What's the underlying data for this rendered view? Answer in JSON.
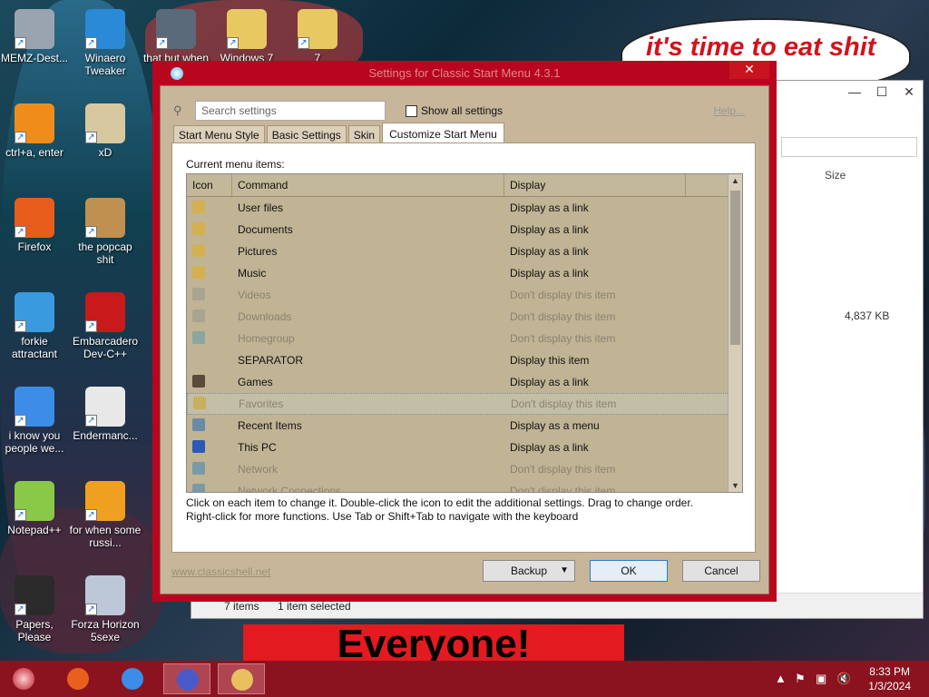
{
  "desktop": {
    "icons": [
      {
        "label": "MEMZ-Dest...",
        "color": "#9aa4b0"
      },
      {
        "label": "Winaero Tweaker",
        "color": "#2a8ad8"
      },
      {
        "label": "that but when",
        "color": "#5a6a7a"
      },
      {
        "label": "Windows 7",
        "color": "#e8c860"
      },
      {
        "label": "7",
        "color": "#e8c860"
      },
      {
        "label": "ctrl+a, enter",
        "color": "#f08c1a"
      },
      {
        "label": "xD",
        "color": "#d8c8a0"
      },
      {
        "label": "Firefox",
        "color": "#e85d1c"
      },
      {
        "label": "the popcap shit",
        "color": "#c09050"
      },
      {
        "label": "forkie attractant",
        "color": "#3a9ae0"
      },
      {
        "label": "Embarcadero Dev-C++",
        "color": "#c81a1a"
      },
      {
        "label": "i know you people we...",
        "color": "#3b8de8"
      },
      {
        "label": "Endermanc...",
        "color": "#e8e8e8"
      },
      {
        "label": "Notepad++",
        "color": "#8ac848"
      },
      {
        "label": "for when some russi...",
        "color": "#f0a020"
      },
      {
        "label": "Papers, Please",
        "color": "#2a2a2a"
      },
      {
        "label": "Forza Horizon 5sexe",
        "color": "#bcc8d8"
      }
    ],
    "meme_top": "it's time to eat shit",
    "meme_bottom": "Everyone!"
  },
  "explorer": {
    "size_header": "Size",
    "size_value": "4,837 KB",
    "items_count": "7 items",
    "selected": "1 item selected",
    "min": "—",
    "max": "☐",
    "close": "✕"
  },
  "dialog": {
    "title": "Settings for Classic Start Menu 4.3.1",
    "close": "✕",
    "search_placeholder": "Search settings",
    "show_all": "Show all settings",
    "help": "Help...",
    "tabs": [
      "Start Menu Style",
      "Basic Settings",
      "Skin",
      "Customize Start Menu"
    ],
    "list_label": "Current menu items:",
    "columns": [
      "Icon",
      "Command",
      "Display"
    ],
    "rows": [
      {
        "command": "User files",
        "display": "Display as a link",
        "dim": false,
        "icon_color": "#d4b050"
      },
      {
        "command": "Documents",
        "display": "Display as a link",
        "dim": false,
        "icon_color": "#d4b050"
      },
      {
        "command": "Pictures",
        "display": "Display as a link",
        "dim": false,
        "icon_color": "#d4b050"
      },
      {
        "command": "Music",
        "display": "Display as a link",
        "dim": false,
        "icon_color": "#d4b050"
      },
      {
        "command": "Videos",
        "display": "Don't display this item",
        "dim": true,
        "icon_color": "#a9a48f"
      },
      {
        "command": "Downloads",
        "display": "Don't display this item",
        "dim": true,
        "icon_color": "#a9a48f"
      },
      {
        "command": "Homegroup",
        "display": "Don't display this item",
        "dim": true,
        "icon_color": "#8aa6a0"
      },
      {
        "command": "SEPARATOR",
        "display": "Display this item",
        "dim": false,
        "icon_color": ""
      },
      {
        "command": "Games",
        "display": "Display as a link",
        "dim": false,
        "icon_color": "#5a4a3a"
      },
      {
        "command": "Favorites",
        "display": "Don't display this item",
        "dim": true,
        "icon_color": "#c8b060",
        "selected": true
      },
      {
        "command": "Recent Items",
        "display": "Display as a menu",
        "dim": false,
        "icon_color": "#6a8aa8"
      },
      {
        "command": "This PC",
        "display": "Display as a link",
        "dim": false,
        "icon_color": "#2a5ab8"
      },
      {
        "command": "Network",
        "display": "Don't display this item",
        "dim": true,
        "icon_color": "#7a9aa8"
      },
      {
        "command": "Network Connections",
        "display": "Don't display this item",
        "dim": true,
        "icon_color": "#7a9aa8"
      }
    ],
    "instructions_1": "Click on each item to change it. Double-click the icon to edit the additional settings. Drag to change order.",
    "instructions_2": "Right-click for more functions. Use Tab or Shift+Tab to navigate with the keyboard",
    "footer_link": "www.classicshell.net",
    "backup": "Backup",
    "ok": "OK",
    "cancel": "Cancel"
  },
  "taskbar": {
    "time": "8:33 PM",
    "date": "1/3/2024",
    "apps": [
      {
        "name": "firefox",
        "color": "#e8601c",
        "active": false
      },
      {
        "name": "chrome",
        "color": "#3b8de8",
        "active": false
      },
      {
        "name": "settings",
        "color": "#4a5ac8",
        "active": true
      },
      {
        "name": "explorer",
        "color": "#e8c060",
        "active": true
      }
    ]
  }
}
